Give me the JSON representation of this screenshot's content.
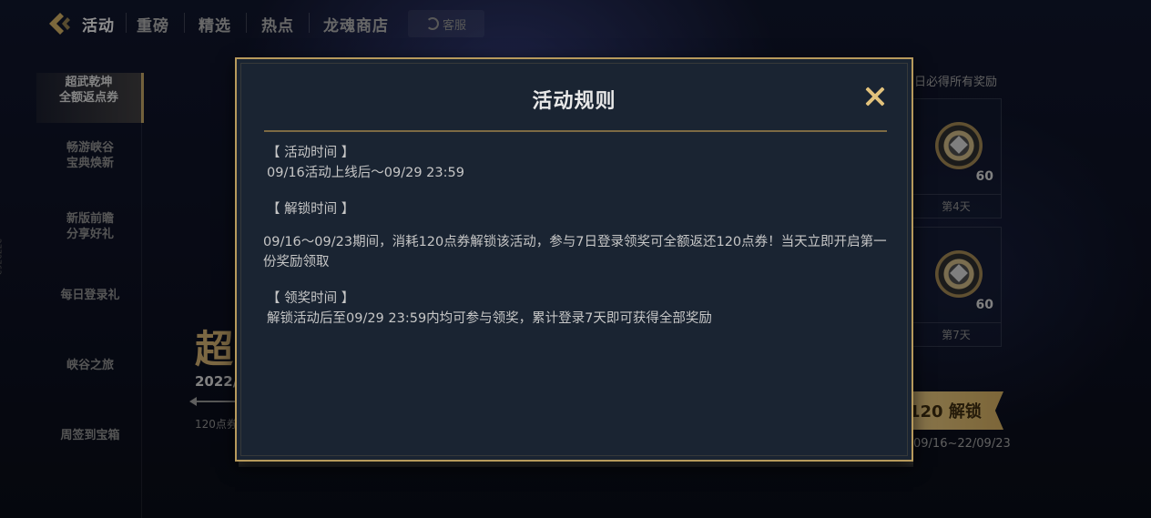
{
  "nav": {
    "items": [
      "活动",
      "重磅",
      "精选",
      "热点",
      "龙魂商店"
    ],
    "service": "客服"
  },
  "sidebar": {
    "items": [
      {
        "line1": "超武乾坤",
        "line2": "全额返点券",
        "active": true
      },
      {
        "line1": "畅游峡谷",
        "line2": "宝典焕新",
        "active": false
      },
      {
        "line1": "新版前瞻",
        "line2": "分享好礼",
        "active": false
      },
      {
        "line1": "每日登录礼",
        "line2": "",
        "active": false
      },
      {
        "line1": "峡谷之旅",
        "line2": "",
        "active": false
      },
      {
        "line1": "周签到宝箱",
        "line2": "",
        "active": false
      }
    ],
    "watermark": "2772763"
  },
  "background": {
    "big_title": "超",
    "date": "2022/",
    "sub_text": "120点券",
    "right_top": "日必得所有奖励",
    "rewards": [
      {
        "qty": "60",
        "day": "第4天"
      },
      {
        "qty": "60",
        "day": "第7天"
      }
    ],
    "unlock_label": "120 解锁",
    "unlock_date": "09/16~22/09/23"
  },
  "modal": {
    "title": "活动规则",
    "sections": [
      {
        "heading": "【 活动时间 】",
        "text": "09/16活动上线后～09/29 23:59"
      },
      {
        "heading": "【 解锁时间 】",
        "text": "09/16～09/23期间，消耗120点券解锁该活动，参与7日登录领奖可全额返还120点券！当天立即开启第一份奖励领取"
      },
      {
        "heading": "【 领奖时间 】",
        "text": "解锁活动后至09/29 23:59内均可参与领奖，累计登录7天即可获得全部奖励"
      }
    ]
  },
  "colors": {
    "accent_gold": "#b79a5c",
    "close_gold": "#e2c27c",
    "modal_bg": "#1a2432"
  }
}
